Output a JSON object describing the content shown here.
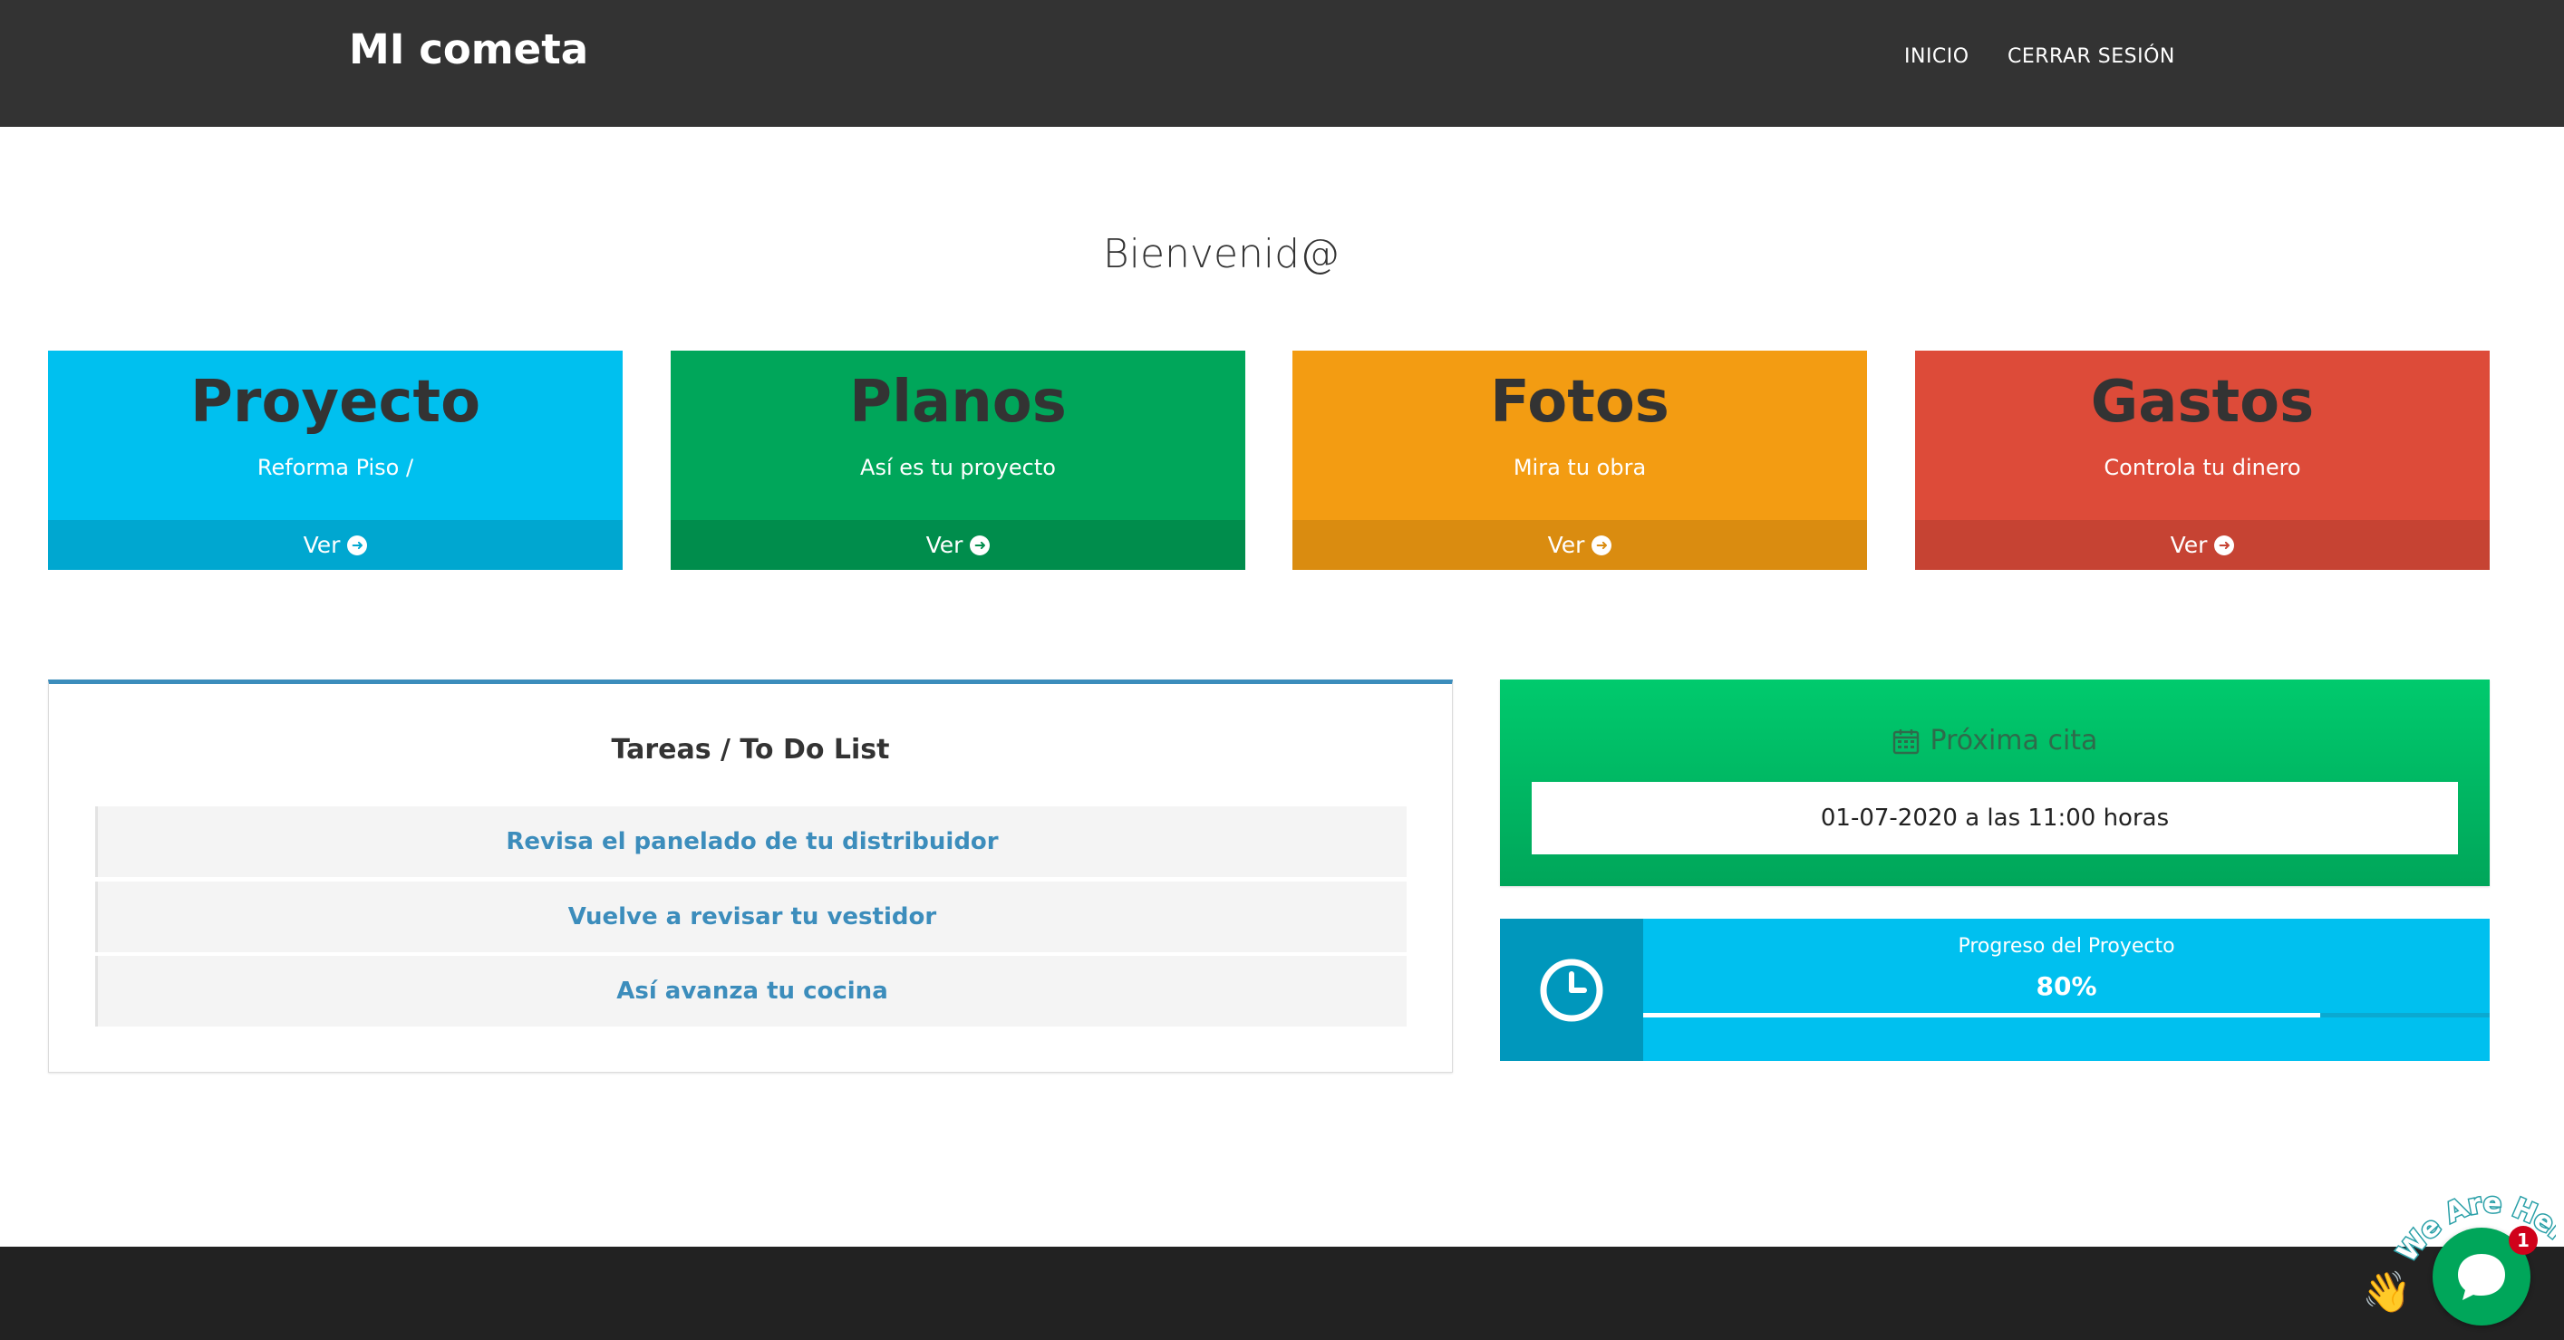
{
  "navbar": {
    "brand": "MI cometa",
    "links": [
      {
        "label": "INICIO"
      },
      {
        "label": "CERRAR SESIÓN"
      }
    ]
  },
  "welcome": {
    "text": "Bienvenid@"
  },
  "tiles": [
    {
      "title": "Proyecto",
      "subtitle": "Reforma Piso /",
      "action": "Ver",
      "color": "#00c0ef"
    },
    {
      "title": "Planos",
      "subtitle": "Así es tu proyecto",
      "action": "Ver",
      "color": "#00a65a"
    },
    {
      "title": "Fotos",
      "subtitle": "Mira tu obra",
      "action": "Ver",
      "color": "#f39c12"
    },
    {
      "title": "Gastos",
      "subtitle": "Controla tu dinero",
      "action": "Ver",
      "color": "#dd4b39"
    }
  ],
  "todo": {
    "title": "Tareas / To Do List",
    "items": [
      {
        "label": "Revisa el panelado de tu distribuidor"
      },
      {
        "label": "Vuelve a revisar tu vestidor"
      },
      {
        "label": "Así avanza tu cocina"
      }
    ]
  },
  "appointment": {
    "title": "Próxima cita",
    "icon": "calendar-icon",
    "value": "01-07-2020 a las 11:00 horas"
  },
  "progress": {
    "label": "Progreso del Proyecto",
    "value_text": "80%",
    "fraction": 0.8,
    "icon": "clock-icon"
  },
  "chat": {
    "banner": "We Are Here!",
    "badge": "1"
  }
}
